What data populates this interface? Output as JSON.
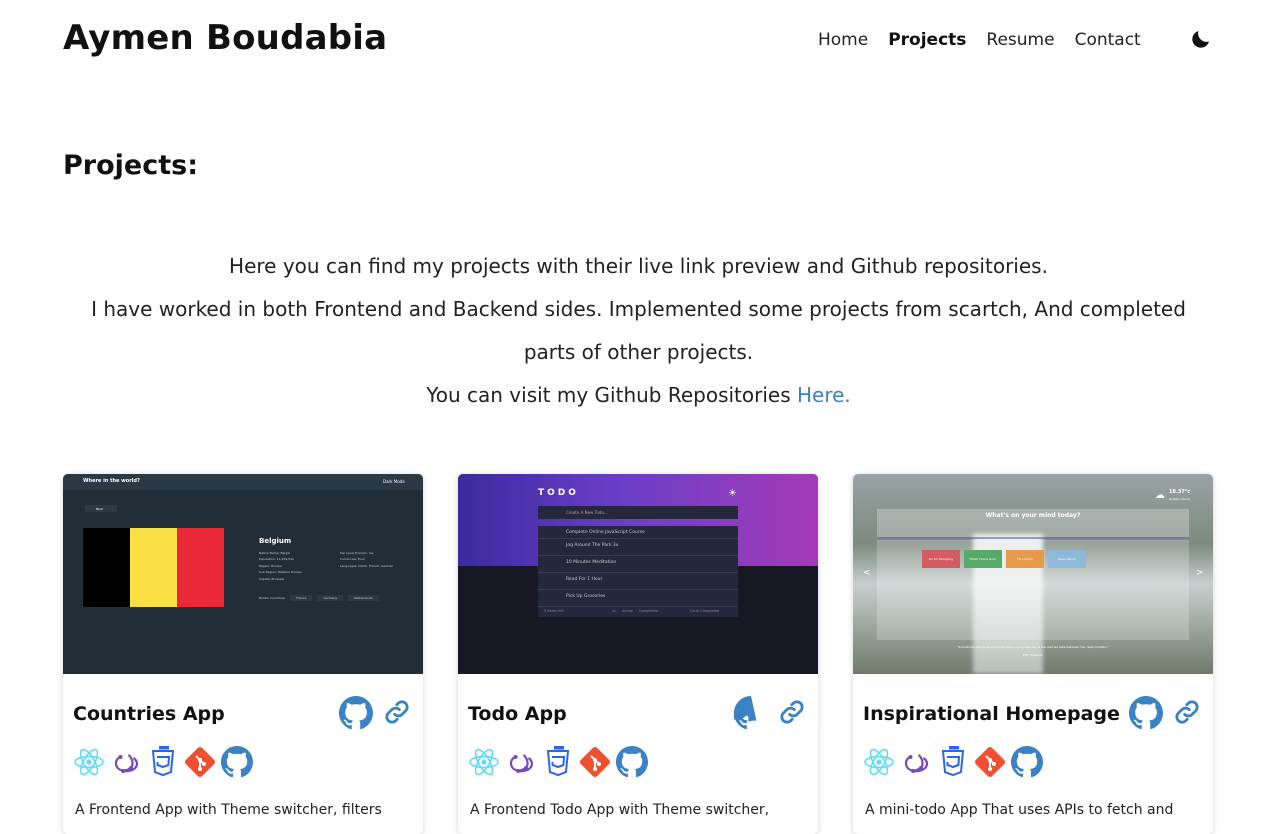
{
  "brand": "Aymen Boudabia",
  "nav": [
    {
      "label": "Home",
      "active": false
    },
    {
      "label": "Projects",
      "active": true
    },
    {
      "label": "Resume",
      "active": false
    },
    {
      "label": "Contact",
      "active": false
    }
  ],
  "theme_toggle_icon": "moon-icon",
  "page_title": "Projects:",
  "intro": {
    "line1": "Here you can find my projects with their live link preview and Github repositories.",
    "line2": "I have worked in both Frontend and Backend sides. Implemented some projects from scartch, And completed parts of other projects.",
    "line3_prefix": "You can visit my Github Repositories ",
    "line3_link": "Here."
  },
  "colors": {
    "link": "#3b82c4",
    "react": "#61dafb",
    "redux": "#764abc",
    "css3": "#2965f1",
    "git": "#f05032",
    "github": "#181717"
  },
  "tech_icons": [
    "react-icon",
    "redux-icon",
    "css3-icon",
    "git-icon",
    "github-icon"
  ],
  "projects": [
    {
      "title": "Countries App",
      "description": "A Frontend App with Theme switcher, filters",
      "preview": {
        "header": "Where in the world?",
        "mode": "Dark Mode",
        "back": "Back",
        "country": "Belgium",
        "details_left": [
          "Native Name: België",
          "Population: 11,319,511",
          "Region: Europe",
          "Sub Region: Western Europe",
          "Capital: Brussels"
        ],
        "details_right": [
          "Top Level Domain: .be",
          "Currencies: Euro",
          "Languages: Dutch, French, German"
        ],
        "border_label": "Border Countries:",
        "borders": [
          "France",
          "Germany",
          "Netherlands"
        ]
      }
    },
    {
      "title": "Todo App",
      "description": "A Frontend Todo App with Theme switcher,",
      "preview": {
        "logo": "TODO",
        "input": "Create A New Todo...",
        "items": [
          "Complete Online JavaScript Course",
          "Jog Around The Park 3x",
          "10 Minutes Meditation",
          "Read For 1 Hour",
          "Pick Up Groceries"
        ],
        "footer_left": "5 items left",
        "filters": [
          "All",
          "Active",
          "Completed"
        ],
        "footer_right": "Clear Completed"
      }
    },
    {
      "title": "Inspirational Homepage",
      "description": "A mini-todo App That uses APIs to fetch and",
      "preview": {
        "weather": "18.37°c",
        "weather_sub": "broken clouds",
        "question": "What's on your mind today?",
        "tasks": [
          "Go for Shopping",
          "Finish Home work",
          "Fix Laptop",
          "Clean Room"
        ],
        "prev": "<",
        "next": ">",
        "quote": "\"Sometimes the most important thing in a whole day is the rest we take between two deep breaths.\"",
        "author": "Etty Hillesum"
      }
    }
  ]
}
